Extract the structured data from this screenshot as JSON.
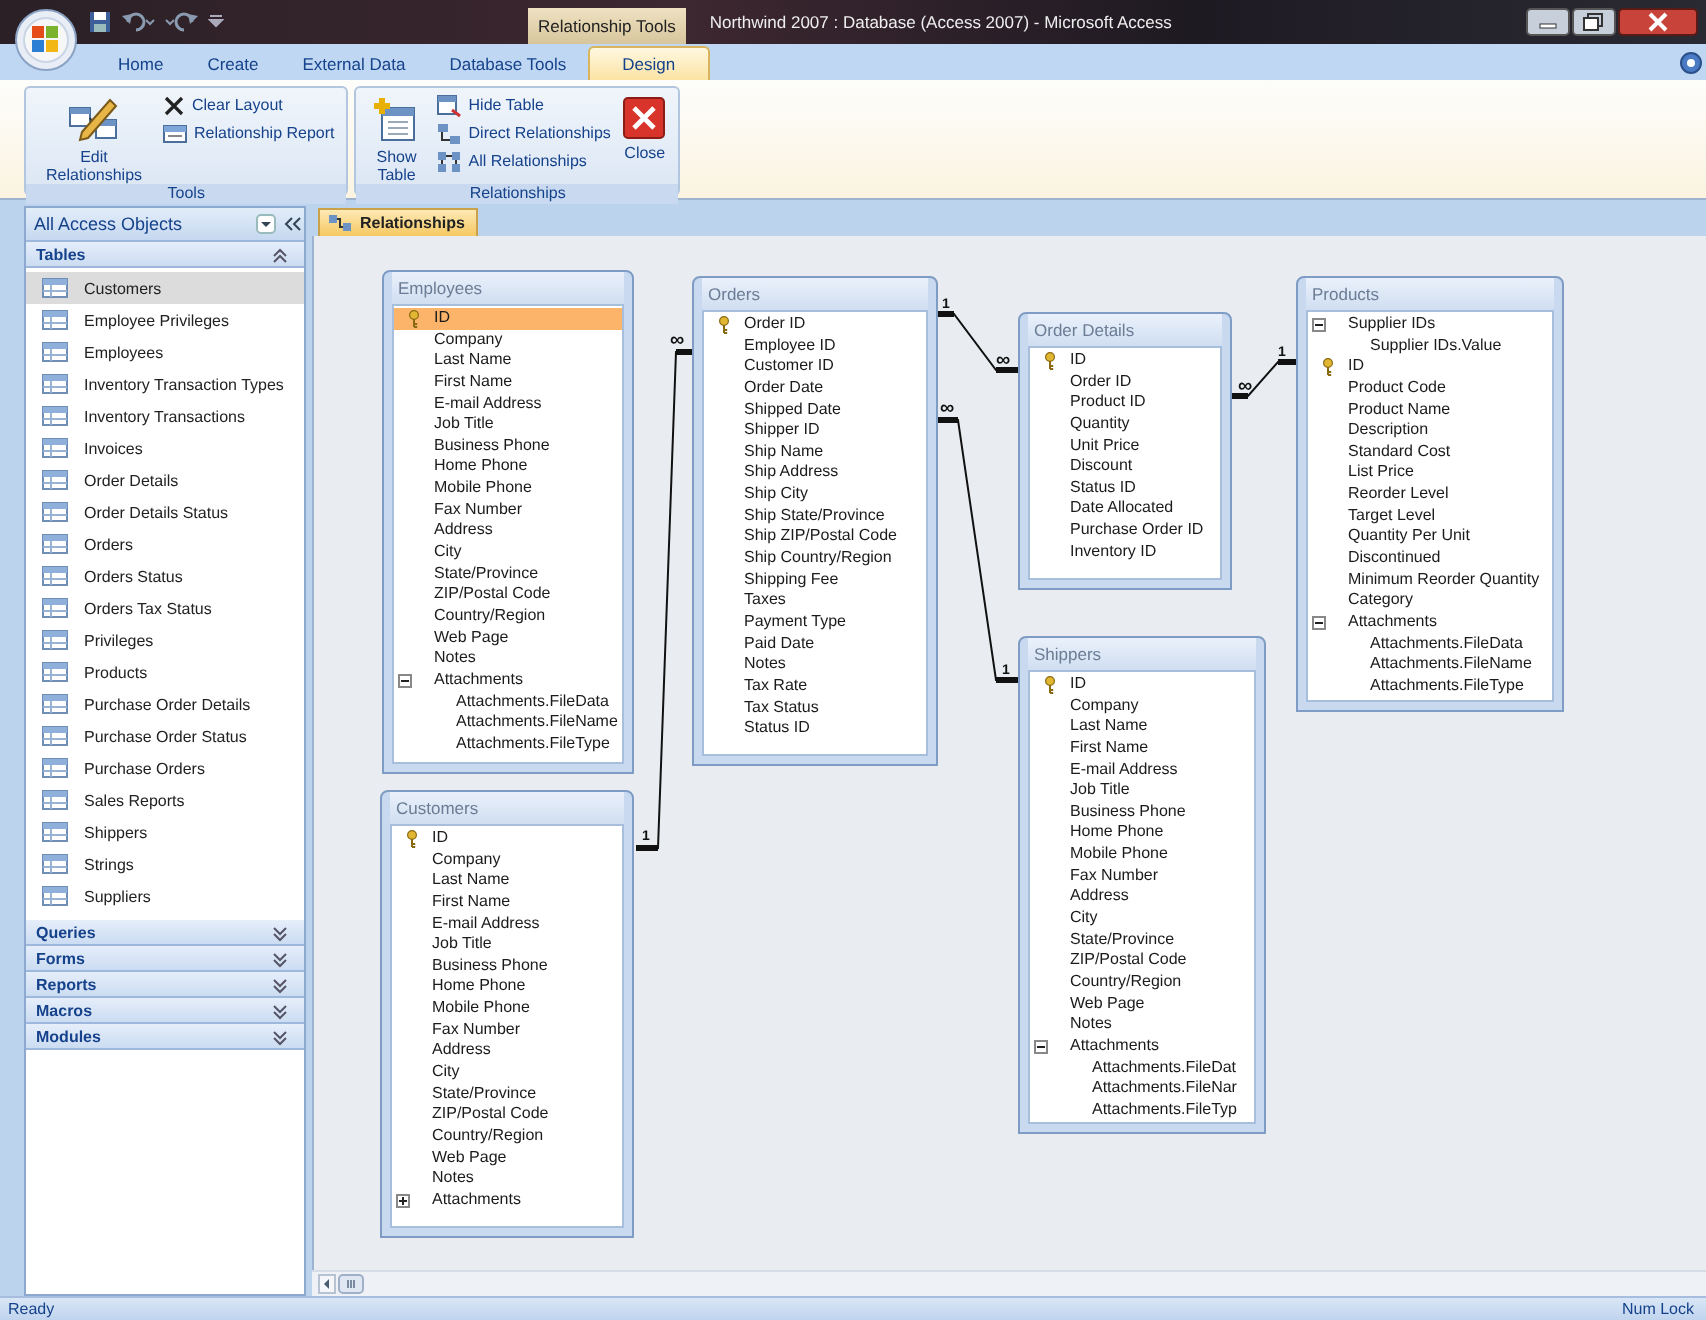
{
  "window": {
    "context": "Relationship Tools",
    "title": "Northwind 2007 : Database (Access 2007) - Microsoft Access"
  },
  "ribbon_tabs": [
    {
      "label": "Home",
      "selected": false
    },
    {
      "label": "Create",
      "selected": false
    },
    {
      "label": "External Data",
      "selected": false
    },
    {
      "label": "Database Tools",
      "selected": false
    },
    {
      "label": "Design",
      "selected": true
    }
  ],
  "ribbon_groups": [
    {
      "label": "Tools",
      "commands": [
        {
          "label": "Edit Relationships",
          "kind": "large"
        },
        {
          "label": "Clear Layout",
          "kind": "small"
        },
        {
          "label": "Relationship Report",
          "kind": "small"
        }
      ]
    },
    {
      "label": "Relationships",
      "commands": [
        {
          "label": "Show Table",
          "kind": "large"
        },
        {
          "label": "Hide Table",
          "kind": "small"
        },
        {
          "label": "Direct Relationships",
          "kind": "small"
        },
        {
          "label": "All Relationships",
          "kind": "small"
        },
        {
          "label": "Close",
          "kind": "large"
        }
      ]
    }
  ],
  "nav": {
    "title": "All Access Objects",
    "groups": [
      {
        "label": "Tables",
        "expanded": true,
        "items": [
          {
            "label": "Customers",
            "selected": true
          },
          {
            "label": "Employee Privileges",
            "selected": false
          },
          {
            "label": "Employees",
            "selected": false
          },
          {
            "label": "Inventory Transaction Types",
            "selected": false
          },
          {
            "label": "Inventory Transactions",
            "selected": false
          },
          {
            "label": "Invoices",
            "selected": false
          },
          {
            "label": "Order Details",
            "selected": false
          },
          {
            "label": "Order Details Status",
            "selected": false
          },
          {
            "label": "Orders",
            "selected": false
          },
          {
            "label": "Orders Status",
            "selected": false
          },
          {
            "label": "Orders Tax Status",
            "selected": false
          },
          {
            "label": "Privileges",
            "selected": false
          },
          {
            "label": "Products",
            "selected": false
          },
          {
            "label": "Purchase Order Details",
            "selected": false
          },
          {
            "label": "Purchase Order Status",
            "selected": false
          },
          {
            "label": "Purchase Orders",
            "selected": false
          },
          {
            "label": "Sales Reports",
            "selected": false
          },
          {
            "label": "Shippers",
            "selected": false
          },
          {
            "label": "Strings",
            "selected": false
          },
          {
            "label": "Suppliers",
            "selected": false
          }
        ]
      },
      {
        "label": "Queries",
        "expanded": false
      },
      {
        "label": "Forms",
        "expanded": false
      },
      {
        "label": "Reports",
        "expanded": false
      },
      {
        "label": "Macros",
        "expanded": false
      },
      {
        "label": "Modules",
        "expanded": false
      }
    ]
  },
  "document_tab": {
    "label": "Relationships"
  },
  "tables": [
    {
      "name": "Employees",
      "fields": [
        {
          "name": "ID",
          "kind": "key",
          "selected": true
        },
        {
          "name": "Company",
          "kind": "field",
          "selected": false
        },
        {
          "name": "Last Name",
          "kind": "field",
          "selected": false
        },
        {
          "name": "First Name",
          "kind": "field",
          "selected": false
        },
        {
          "name": "E-mail Address",
          "kind": "field",
          "selected": false
        },
        {
          "name": "Job Title",
          "kind": "field",
          "selected": false
        },
        {
          "name": "Business Phone",
          "kind": "field",
          "selected": false
        },
        {
          "name": "Home Phone",
          "kind": "field",
          "selected": false
        },
        {
          "name": "Mobile Phone",
          "kind": "field",
          "selected": false
        },
        {
          "name": "Fax Number",
          "kind": "field",
          "selected": false
        },
        {
          "name": "Address",
          "kind": "field",
          "selected": false
        },
        {
          "name": "City",
          "kind": "field",
          "selected": false
        },
        {
          "name": "State/Province",
          "kind": "field",
          "selected": false
        },
        {
          "name": "ZIP/Postal Code",
          "kind": "field",
          "selected": false
        },
        {
          "name": "Country/Region",
          "kind": "field",
          "selected": false
        },
        {
          "name": "Web Page",
          "kind": "field",
          "selected": false
        },
        {
          "name": "Notes",
          "kind": "field",
          "selected": false
        },
        {
          "name": "Attachments",
          "kind": "group",
          "expanded": true,
          "selected": false
        },
        {
          "name": "Attachments.FileData",
          "kind": "subfield",
          "selected": false
        },
        {
          "name": "Attachments.FileName",
          "kind": "subfield",
          "selected": false
        },
        {
          "name": "Attachments.FileType",
          "kind": "subfield",
          "selected": false
        }
      ]
    },
    {
      "name": "Orders",
      "fields": [
        {
          "name": "Order ID",
          "kind": "key",
          "selected": false
        },
        {
          "name": "Employee ID",
          "kind": "field",
          "selected": false
        },
        {
          "name": "Customer ID",
          "kind": "field",
          "selected": false
        },
        {
          "name": "Order Date",
          "kind": "field",
          "selected": false
        },
        {
          "name": "Shipped Date",
          "kind": "field",
          "selected": false
        },
        {
          "name": "Shipper ID",
          "kind": "field",
          "selected": false
        },
        {
          "name": "Ship Name",
          "kind": "field",
          "selected": false
        },
        {
          "name": "Ship Address",
          "kind": "field",
          "selected": false
        },
        {
          "name": "Ship City",
          "kind": "field",
          "selected": false
        },
        {
          "name": "Ship State/Province",
          "kind": "field",
          "selected": false
        },
        {
          "name": "Ship ZIP/Postal Code",
          "kind": "field",
          "selected": false
        },
        {
          "name": "Ship Country/Region",
          "kind": "field",
          "selected": false
        },
        {
          "name": "Shipping Fee",
          "kind": "field",
          "selected": false
        },
        {
          "name": "Taxes",
          "kind": "field",
          "selected": false
        },
        {
          "name": "Payment Type",
          "kind": "field",
          "selected": false
        },
        {
          "name": "Paid Date",
          "kind": "field",
          "selected": false
        },
        {
          "name": "Notes",
          "kind": "field",
          "selected": false
        },
        {
          "name": "Tax Rate",
          "kind": "field",
          "selected": false
        },
        {
          "name": "Tax Status",
          "kind": "field",
          "selected": false
        },
        {
          "name": "Status ID",
          "kind": "field",
          "selected": false
        }
      ]
    },
    {
      "name": "Order Details",
      "fields": [
        {
          "name": "ID",
          "kind": "key",
          "selected": false
        },
        {
          "name": "Order ID",
          "kind": "field",
          "selected": false
        },
        {
          "name": "Product ID",
          "kind": "field",
          "selected": false
        },
        {
          "name": "Quantity",
          "kind": "field",
          "selected": false
        },
        {
          "name": "Unit Price",
          "kind": "field",
          "selected": false
        },
        {
          "name": "Discount",
          "kind": "field",
          "selected": false
        },
        {
          "name": "Status ID",
          "kind": "field",
          "selected": false
        },
        {
          "name": "Date Allocated",
          "kind": "field",
          "selected": false
        },
        {
          "name": "Purchase Order ID",
          "kind": "field",
          "selected": false
        },
        {
          "name": "Inventory ID",
          "kind": "field",
          "selected": false
        }
      ]
    },
    {
      "name": "Products",
      "fields": [
        {
          "name": "Supplier IDs",
          "kind": "group",
          "expanded": true,
          "selected": false
        },
        {
          "name": "Supplier IDs.Value",
          "kind": "subfield",
          "selected": false
        },
        {
          "name": "ID",
          "kind": "key",
          "selected": false
        },
        {
          "name": "Product Code",
          "kind": "field",
          "selected": false
        },
        {
          "name": "Product Name",
          "kind": "field",
          "selected": false
        },
        {
          "name": "Description",
          "kind": "field",
          "selected": false
        },
        {
          "name": "Standard Cost",
          "kind": "field",
          "selected": false
        },
        {
          "name": "List Price",
          "kind": "field",
          "selected": false
        },
        {
          "name": "Reorder Level",
          "kind": "field",
          "selected": false
        },
        {
          "name": "Target Level",
          "kind": "field",
          "selected": false
        },
        {
          "name": "Quantity Per Unit",
          "kind": "field",
          "selected": false
        },
        {
          "name": "Discontinued",
          "kind": "field",
          "selected": false
        },
        {
          "name": "Minimum Reorder Quantity",
          "kind": "field",
          "selected": false
        },
        {
          "name": "Category",
          "kind": "field",
          "selected": false
        },
        {
          "name": "Attachments",
          "kind": "group",
          "expanded": true,
          "selected": false
        },
        {
          "name": "Attachments.FileData",
          "kind": "subfield",
          "selected": false
        },
        {
          "name": "Attachments.FileName",
          "kind": "subfield",
          "selected": false
        },
        {
          "name": "Attachments.FileType",
          "kind": "subfield",
          "selected": false
        }
      ]
    },
    {
      "name": "Customers",
      "fields": [
        {
          "name": "ID",
          "kind": "key",
          "selected": false
        },
        {
          "name": "Company",
          "kind": "field",
          "selected": false
        },
        {
          "name": "Last Name",
          "kind": "field",
          "selected": false
        },
        {
          "name": "First Name",
          "kind": "field",
          "selected": false
        },
        {
          "name": "E-mail Address",
          "kind": "field",
          "selected": false
        },
        {
          "name": "Job Title",
          "kind": "field",
          "selected": false
        },
        {
          "name": "Business Phone",
          "kind": "field",
          "selected": false
        },
        {
          "name": "Home Phone",
          "kind": "field",
          "selected": false
        },
        {
          "name": "Mobile Phone",
          "kind": "field",
          "selected": false
        },
        {
          "name": "Fax Number",
          "kind": "field",
          "selected": false
        },
        {
          "name": "Address",
          "kind": "field",
          "selected": false
        },
        {
          "name": "City",
          "kind": "field",
          "selected": false
        },
        {
          "name": "State/Province",
          "kind": "field",
          "selected": false
        },
        {
          "name": "ZIP/Postal Code",
          "kind": "field",
          "selected": false
        },
        {
          "name": "Country/Region",
          "kind": "field",
          "selected": false
        },
        {
          "name": "Web Page",
          "kind": "field",
          "selected": false
        },
        {
          "name": "Notes",
          "kind": "field",
          "selected": false
        },
        {
          "name": "Attachments",
          "kind": "group",
          "expanded": false,
          "selected": false
        }
      ]
    },
    {
      "name": "Shippers",
      "fields": [
        {
          "name": "ID",
          "kind": "key",
          "selected": false
        },
        {
          "name": "Company",
          "kind": "field",
          "selected": false
        },
        {
          "name": "Last Name",
          "kind": "field",
          "selected": false
        },
        {
          "name": "First Name",
          "kind": "field",
          "selected": false
        },
        {
          "name": "E-mail Address",
          "kind": "field",
          "selected": false
        },
        {
          "name": "Job Title",
          "kind": "field",
          "selected": false
        },
        {
          "name": "Business Phone",
          "kind": "field",
          "selected": false
        },
        {
          "name": "Home Phone",
          "kind": "field",
          "selected": false
        },
        {
          "name": "Mobile Phone",
          "kind": "field",
          "selected": false
        },
        {
          "name": "Fax Number",
          "kind": "field",
          "selected": false
        },
        {
          "name": "Address",
          "kind": "field",
          "selected": false
        },
        {
          "name": "City",
          "kind": "field",
          "selected": false
        },
        {
          "name": "State/Province",
          "kind": "field",
          "selected": false
        },
        {
          "name": "ZIP/Postal Code",
          "kind": "field",
          "selected": false
        },
        {
          "name": "Country/Region",
          "kind": "field",
          "selected": false
        },
        {
          "name": "Web Page",
          "kind": "field",
          "selected": false
        },
        {
          "name": "Notes",
          "kind": "field",
          "selected": false
        },
        {
          "name": "Attachments",
          "kind": "group",
          "expanded": true,
          "selected": false
        },
        {
          "name": "Attachments.FileDat",
          "kind": "subfield",
          "selected": false
        },
        {
          "name": "Attachments.FileNar",
          "kind": "subfield",
          "selected": false
        },
        {
          "name": "Attachments.FileTyp",
          "kind": "subfield",
          "selected": false
        }
      ]
    }
  ],
  "relationships": [
    {
      "one_label": "1",
      "many_label": "∞"
    },
    {
      "one_label": "1",
      "many_label": "∞"
    },
    {
      "one_label": "1",
      "many_label": "∞"
    },
    {
      "one_label": "1",
      "many_label": "∞"
    }
  ],
  "status_bar": {
    "left": "Ready",
    "right": "Num Lock"
  }
}
